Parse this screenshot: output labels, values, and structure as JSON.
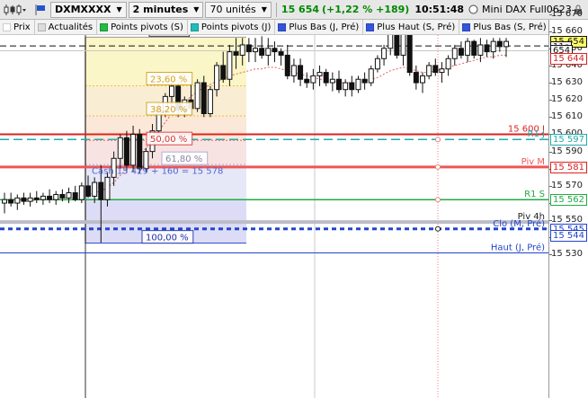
{
  "toolbar": {
    "symbol": "DXMXXXX",
    "period": "2 minutes",
    "units": "70 unités",
    "price": "15 654",
    "change": "(+1,22 % +189)",
    "time": "10:51:48",
    "instrument": "Mini DAX Full0623",
    "colors": {
      "up": "#008800",
      "flag": "#2255cc"
    }
  },
  "tabs": [
    {
      "label": "Prix",
      "color": "#ffffff"
    },
    {
      "label": "Actualités",
      "color": "#dddddd"
    },
    {
      "label": "Points pivots (S)",
      "color": "#22bb44"
    },
    {
      "label": "Points pivots (J)",
      "color": "#22bbbb"
    },
    {
      "label": "Plus Bas (J, Pré)",
      "color": "#3355dd"
    },
    {
      "label": "Plus Haut (S, Pré)",
      "color": "#3355dd"
    },
    {
      "label": "Plus Bas (S, Pré)",
      "color": "#3355dd"
    }
  ],
  "axis": {
    "ticks": [
      "15 670",
      "15 660",
      "15 650",
      "15 640",
      "15 630",
      "15 620",
      "15 610",
      "15 600",
      "15 590",
      "15 580",
      "15 570",
      "15 560",
      "15 550",
      "15 540",
      "15 530"
    ],
    "tags": [
      {
        "text": "15 654",
        "color": "#111111",
        "bg": "#ffff66",
        "price": 15654
      },
      {
        "text": "11s",
        "color": "#111111",
        "bg": "#ffffff",
        "price": 15651
      },
      {
        "text": "654",
        "color": "#111111",
        "bg": "#ffffff",
        "price": 15648.6
      },
      {
        "text": "15 644",
        "color": "#dd2222",
        "bg": "#ffffff",
        "price": 15644
      },
      {
        "text": "15 597",
        "color": "#22aaaa",
        "bg": "#ffffff",
        "price": 15597
      },
      {
        "text": "15 581",
        "color": "#dd2222",
        "bg": "#ffffff",
        "price": 15581
      },
      {
        "text": "15 562",
        "color": "#22aa44",
        "bg": "#ffffff",
        "price": 15562
      },
      {
        "text": "15 545",
        "color": "#2244cc",
        "bg": "#ffffff",
        "price": 15545
      },
      {
        "text": "15 544",
        "color": "#2244cc",
        "bg": "#ffffff",
        "price": 15541
      }
    ]
  },
  "fib": {
    "labels": [
      "0,00 %",
      "23,60 %",
      "38,20 %",
      "50,00 %",
      "61,80 %",
      "100,00 %"
    ],
    "prices": [
      15656.5,
      15628.2,
      15610.7,
      15596.5,
      15582.4,
      15536.7
    ]
  },
  "levels": [
    {
      "label": "15 600 J",
      "price": 15600,
      "color": "#dd2222"
    },
    {
      "label": "R1 J",
      "price": 15597,
      "color": "#22aaaa"
    },
    {
      "label": "Piv M",
      "price": 15581,
      "color": "#ee5555"
    },
    {
      "label": "R1 S",
      "price": 15562,
      "color": "#22aa44"
    },
    {
      "label": "Piv 4h",
      "price": 15549,
      "color": "#333333"
    },
    {
      "label": "Clo (M, Pré)",
      "price": 15545,
      "color": "#2244cc"
    },
    {
      "label": "Haut (J, Pré)",
      "price": 15531,
      "color": "#2244cc"
    }
  ],
  "annotation": "Cash 15 429 + 160 = 15 578",
  "chart_data": {
    "type": "candlestick",
    "y_range": [
      15528,
      15672
    ],
    "candles": [
      [
        15560,
        15566,
        15554,
        15562
      ],
      [
        15562,
        15566,
        15558,
        15560
      ],
      [
        15560,
        15565,
        15556,
        15563
      ],
      [
        15563,
        15566,
        15559,
        15561
      ],
      [
        15561,
        15566,
        15558,
        15563
      ],
      [
        15563,
        15567,
        15560,
        15562
      ],
      [
        15562,
        15566,
        15559,
        15564
      ],
      [
        15564,
        15568,
        15560,
        15562
      ],
      [
        15562,
        15567,
        15559,
        15565
      ],
      [
        15565,
        15568,
        15561,
        15563
      ],
      [
        15563,
        15569,
        15560,
        15566
      ],
      [
        15566,
        15570,
        15561,
        15562
      ],
      [
        15562,
        15572,
        15560,
        15570
      ],
      [
        15570,
        15576,
        15563,
        15564
      ],
      [
        15564,
        15575,
        15560,
        15572
      ],
      [
        15572,
        15582,
        15537,
        15562
      ],
      [
        15562,
        15578,
        15558,
        15575
      ],
      [
        15575,
        15590,
        15570,
        15586
      ],
      [
        15586,
        15600,
        15580,
        15598
      ],
      [
        15598,
        15602,
        15578,
        15582
      ],
      [
        15582,
        15605,
        15578,
        15600
      ],
      [
        15600,
        15603,
        15577,
        15580
      ],
      [
        15580,
        15592,
        15578,
        15590
      ],
      [
        15590,
        15606,
        15586,
        15602
      ],
      [
        15602,
        15618,
        15598,
        15614
      ],
      [
        15614,
        15624,
        15610,
        15622
      ],
      [
        15622,
        15630,
        15616,
        15628
      ],
      [
        15628,
        15630,
        15610,
        15614
      ],
      [
        15614,
        15622,
        15610,
        15620
      ],
      [
        15620,
        15630,
        15612,
        15615
      ],
      [
        15615,
        15632,
        15613,
        15630
      ],
      [
        15630,
        15634,
        15610,
        15612
      ],
      [
        15612,
        15628,
        15610,
        15626
      ],
      [
        15626,
        15642,
        15622,
        15640
      ],
      [
        15640,
        15648,
        15630,
        15632
      ],
      [
        15632,
        15652,
        15628,
        15648
      ],
      [
        15648,
        15656,
        15638,
        15646
      ],
      [
        15646,
        15656,
        15640,
        15652
      ],
      [
        15652,
        15656,
        15642,
        15648
      ],
      [
        15648,
        15656,
        15642,
        15650
      ],
      [
        15650,
        15657,
        15644,
        15646
      ],
      [
        15646,
        15656,
        15640,
        15650
      ],
      [
        15650,
        15654,
        15642,
        15648
      ],
      [
        15648,
        15650,
        15640,
        15646
      ],
      [
        15646,
        15652,
        15632,
        15634
      ],
      [
        15634,
        15644,
        15630,
        15640
      ],
      [
        15640,
        15644,
        15628,
        15632
      ],
      [
        15632,
        15636,
        15627,
        15630
      ],
      [
        15630,
        15638,
        15626,
        15634
      ],
      [
        15634,
        15640,
        15628,
        15636
      ],
      [
        15636,
        15638,
        15628,
        15630
      ],
      [
        15630,
        15636,
        15625,
        15632
      ],
      [
        15632,
        15637,
        15624,
        15626
      ],
      [
        15626,
        15632,
        15622,
        15630
      ],
      [
        15630,
        15634,
        15622,
        15626
      ],
      [
        15626,
        15634,
        15624,
        15632
      ],
      [
        15632,
        15636,
        15626,
        15630
      ],
      [
        15630,
        15640,
        15628,
        15638
      ],
      [
        15638,
        15646,
        15636,
        15644
      ],
      [
        15644,
        15652,
        15640,
        15650
      ],
      [
        15650,
        15662,
        15646,
        15660
      ],
      [
        15660,
        15662,
        15644,
        15646
      ],
      [
        15646,
        15660,
        15640,
        15658
      ],
      [
        15658,
        15660,
        15634,
        15636
      ],
      [
        15636,
        15640,
        15626,
        15630
      ],
      [
        15630,
        15636,
        15624,
        15634
      ],
      [
        15634,
        15642,
        15632,
        15640
      ],
      [
        15640,
        15644,
        15634,
        15636
      ],
      [
        15636,
        15642,
        15630,
        15638
      ],
      [
        15638,
        15646,
        15634,
        15644
      ],
      [
        15644,
        15652,
        15640,
        15650
      ],
      [
        15650,
        15654,
        15644,
        15646
      ],
      [
        15646,
        15656,
        15642,
        15654
      ],
      [
        15654,
        15655,
        15644,
        15646
      ],
      [
        15646,
        15656,
        15642,
        15652
      ],
      [
        15652,
        15655,
        15645,
        15648
      ],
      [
        15648,
        15656,
        15644,
        15654
      ],
      [
        15654,
        15656,
        15648,
        15651
      ],
      [
        15651,
        15656,
        15645,
        15654
      ]
    ],
    "moving_average": [
      15560,
      15560,
      15561,
      15561,
      15561,
      15562,
      15562,
      15562,
      15562,
      15563,
      15563,
      15563,
      15564,
      15565,
      15566,
      15567,
      15569,
      15572,
      15576,
      15580,
      15584,
      15588,
      15592,
      15597,
      15602,
      15607,
      15612,
      15616,
      15619,
      15622,
      15625,
      15627,
      15629,
      15631,
      15632,
      15634,
      15635,
      15636,
      15637,
      15638,
      15638,
      15639,
      15639,
      15638,
      15637,
      15636,
      15635,
      15634,
      15633,
      15632,
      15632,
      15631,
      15630,
      15630,
      15630,
      15630,
      15631,
      15632,
      15633,
      15635,
      15637,
      15638,
      15639,
      15638,
      15637,
      15636,
      15636,
      15637,
      15638,
      15639,
      15640,
      15641,
      15642,
      15643,
      15644,
      15645,
      15645,
      15646,
      15646
    ]
  }
}
